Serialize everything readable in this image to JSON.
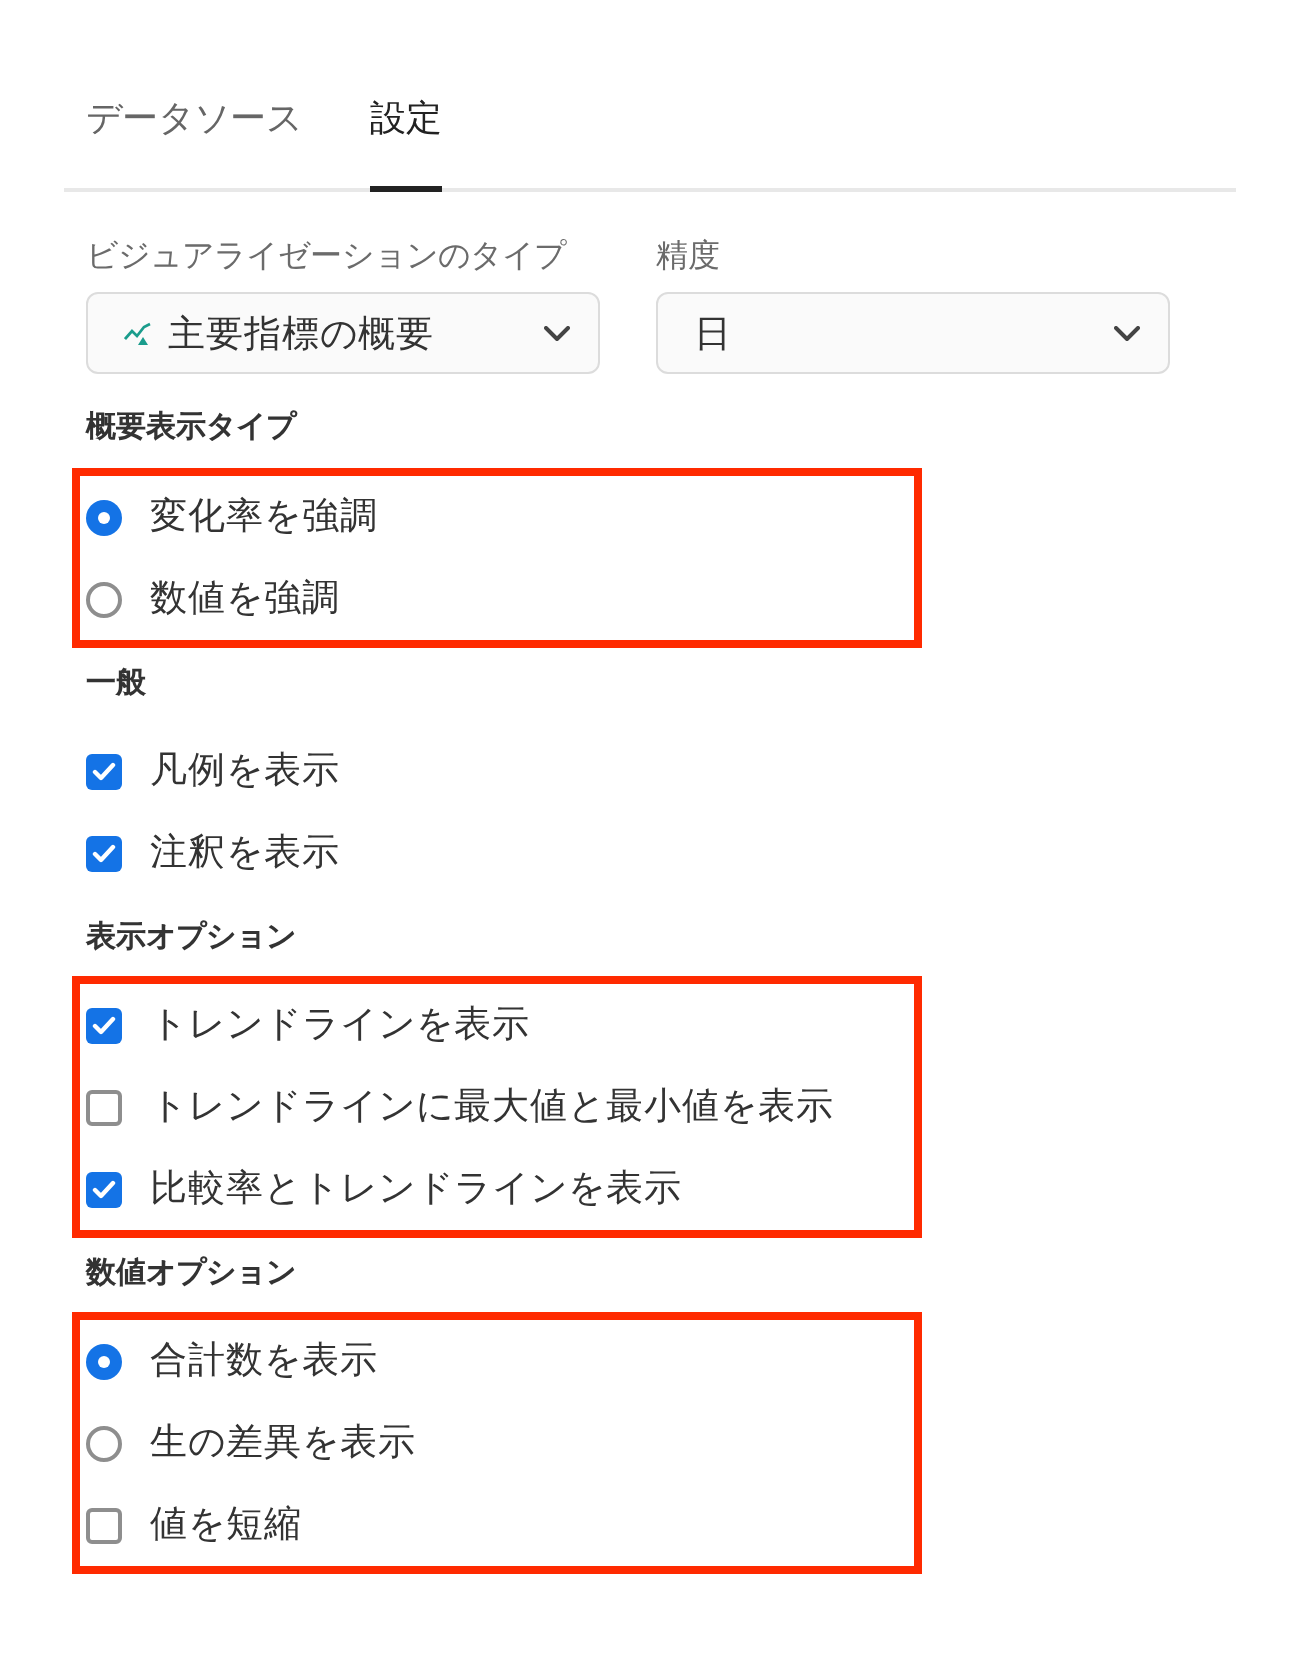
{
  "tabs": [
    {
      "label": "データソース",
      "selected": false
    },
    {
      "label": "設定",
      "selected": true
    }
  ],
  "dropdowns": [
    {
      "kind": "chart",
      "label": "ビジュアライゼーションのタイプ",
      "value": "主要指標の概要"
    },
    {
      "kind": "text",
      "label": "精度",
      "value": "日"
    }
  ],
  "groups": [
    {
      "title": "概要表示タイプ",
      "highlighted": true,
      "options": [
        {
          "kind": "radio",
          "label": "変化率を強調",
          "selected": true
        },
        {
          "kind": "radio",
          "label": "数値を強調",
          "selected": false
        }
      ]
    },
    {
      "title": "一般",
      "highlighted": false,
      "options": [
        {
          "kind": "checkbox",
          "label": "凡例を表示",
          "checked": true
        },
        {
          "kind": "checkbox",
          "label": "注釈を表示",
          "checked": true
        }
      ]
    },
    {
      "title": "表示オプション",
      "highlighted": true,
      "options": [
        {
          "kind": "checkbox",
          "label": "トレンドラインを表示",
          "checked": true
        },
        {
          "kind": "checkbox",
          "label": "トレンドラインに最大値と最小値を表示",
          "checked": false
        },
        {
          "kind": "checkbox",
          "label": "比較率とトレンドラインを表示",
          "checked": true
        }
      ]
    },
    {
      "title": "数値オプション",
      "highlighted": true,
      "options": [
        {
          "kind": "radio",
          "label": "合計数を表示",
          "selected": true
        },
        {
          "kind": "radio",
          "label": "生の差異を表示",
          "selected": false
        },
        {
          "kind": "checkbox",
          "label": "値を短縮",
          "checked": false
        }
      ]
    }
  ]
}
